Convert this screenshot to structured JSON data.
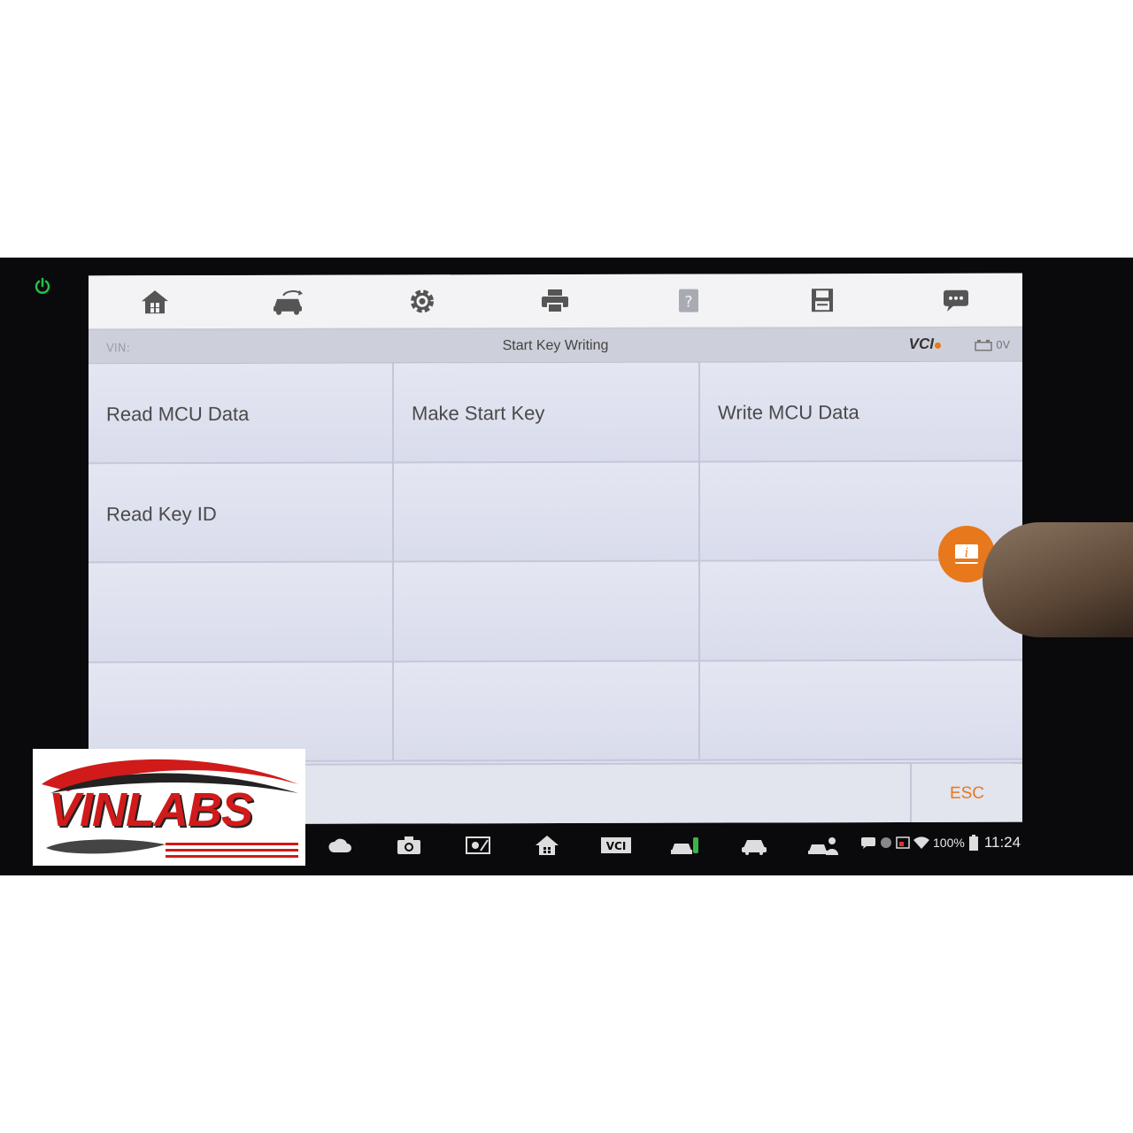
{
  "toolbar": {
    "icons": [
      "home-icon",
      "vehicle-swap-icon",
      "gear-icon",
      "print-icon",
      "help-icon",
      "save-icon",
      "message-icon"
    ]
  },
  "infobar": {
    "vin_label": "VIN:",
    "title": "Start Key Writing",
    "vci_label": "VCI",
    "voltage": "0V"
  },
  "menu": {
    "items": [
      {
        "label": "Read MCU Data"
      },
      {
        "label": "Make Start Key"
      },
      {
        "label": "Write MCU Data"
      },
      {
        "label": "Read Key ID"
      }
    ]
  },
  "footer": {
    "esc_label": "ESC"
  },
  "status": {
    "battery": "100%",
    "time": "11:24"
  },
  "logo": {
    "text": "VINLABS"
  },
  "colors": {
    "accent": "#e8781c",
    "power": "#22c04a",
    "logo_red": "#d11a1a"
  }
}
